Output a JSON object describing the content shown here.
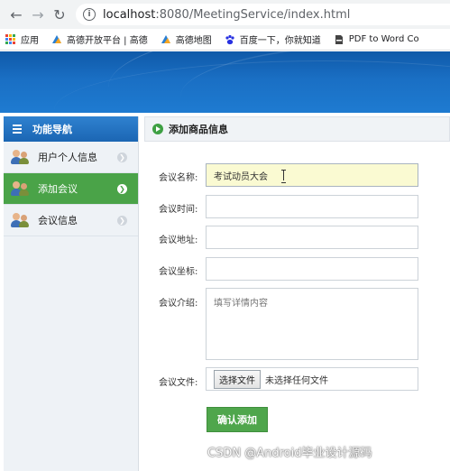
{
  "browser": {
    "url_host": "localhost",
    "url_port": ":8080",
    "url_path": "/MeetingService/index.html",
    "bookmarks": [
      {
        "label": "应用",
        "icon": "apps-grid-icon"
      },
      {
        "label": "高德开放平台 | 高德",
        "icon": "amap-icon"
      },
      {
        "label": "高德地图",
        "icon": "amap-icon"
      },
      {
        "label": "百度一下，你就知道",
        "icon": "baidu-paw-icon"
      },
      {
        "label": "PDF to Word Co",
        "icon": "pdf-icon"
      }
    ]
  },
  "sidebar": {
    "title": "功能导航",
    "items": [
      {
        "label": "用户个人信息",
        "active": false
      },
      {
        "label": "添加会议",
        "active": true
      },
      {
        "label": "会议信息",
        "active": false
      }
    ]
  },
  "panel": {
    "title": "添加商品信息"
  },
  "form": {
    "name_label": "会议名称:",
    "name_value": "考试动员大会",
    "time_label": "会议时间:",
    "time_value": "",
    "address_label": "会议地址:",
    "address_value": "",
    "coord_label": "会议坐标:",
    "coord_value": "",
    "intro_label": "会议介绍:",
    "intro_placeholder": "填写详情内容",
    "file_label": "会议文件:",
    "file_button": "选择文件",
    "file_status": "未选择任何文件",
    "submit": "确认添加"
  },
  "watermark": "CSDN @Android毕业设计源码",
  "colors": {
    "banner": "#1a6fc4",
    "active_green": "#4aa348",
    "highlight_input": "#fafad2"
  }
}
